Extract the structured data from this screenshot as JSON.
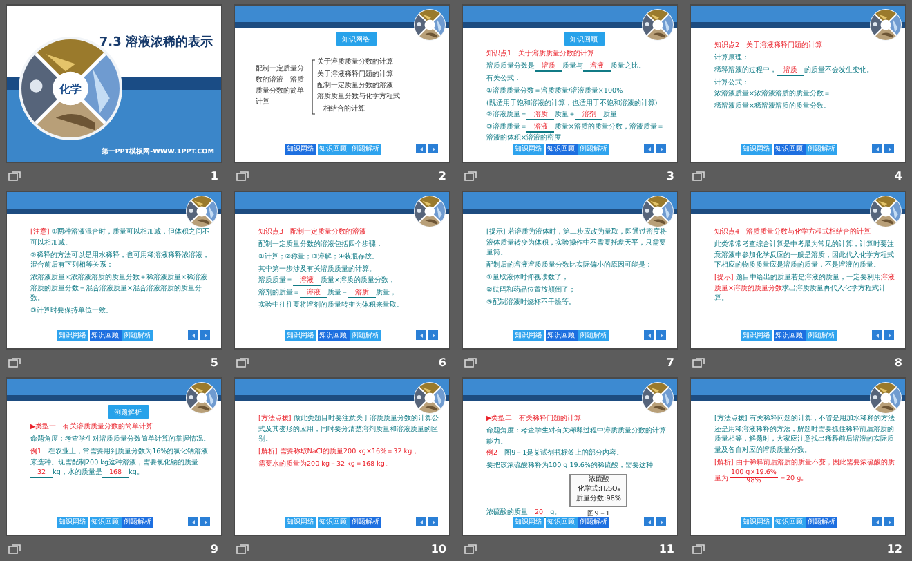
{
  "slides": [
    {
      "number": "1",
      "kind": "title",
      "title": "7.3  溶液浓稀的表示",
      "badge": "化学",
      "credit": "第一PPT模板网-WWW.1PPT.COM"
    },
    {
      "number": "2",
      "kind": "map",
      "heading": "知识网络",
      "map": {
        "topic": "配制一定质量分数的溶液　溶质质量分数的简单计算",
        "branches": [
          "关于溶质质量分数的计算",
          "关于溶液稀释问题的计算",
          "配制一定质量分数的溶液",
          "溶质质量分数与化学方程式相结合的计算"
        ]
      },
      "nav": [
        {
          "label": "知识网络",
          "selected": true
        },
        {
          "label": "知识回顾",
          "selected": false
        },
        {
          "label": "例题解析",
          "selected": false
        }
      ]
    },
    {
      "number": "3",
      "kind": "text",
      "heading": "知识回顾",
      "lines": [
        [
          {
            "kind": "red",
            "text": "知识点1　关于溶质质量分数的计算"
          }
        ],
        [
          {
            "kind": "text",
            "text": "溶质质量分数是"
          },
          {
            "kind": "blank",
            "text": "溶质"
          },
          {
            "kind": "text",
            "text": "质量与"
          },
          {
            "kind": "blank",
            "text": "溶液"
          },
          {
            "kind": "text",
            "text": "质量之比。"
          }
        ],
        [
          {
            "kind": "text",
            "text": "有关公式："
          }
        ],
        [
          {
            "kind": "text",
            "text": "①溶质质量分数＝溶质质量/溶液质量×100%"
          }
        ],
        [
          {
            "kind": "text",
            "text": "(既适用于饱和溶液的计算，也适用于不饱和溶液的计算)"
          }
        ],
        [
          {
            "kind": "text",
            "text": "②溶液质量＝"
          },
          {
            "kind": "blank",
            "text": "溶质"
          },
          {
            "kind": "text",
            "text": "质量＋"
          },
          {
            "kind": "blank",
            "text": "溶剂"
          },
          {
            "kind": "text",
            "text": "质量"
          }
        ],
        [
          {
            "kind": "text",
            "text": "③溶质质量＝"
          },
          {
            "kind": "blank",
            "text": "溶液"
          },
          {
            "kind": "text",
            "text": "质量×溶质的质量分数，溶液质量＝溶液的体积×溶液的密度"
          }
        ]
      ],
      "nav": [
        {
          "label": "知识网络",
          "selected": false
        },
        {
          "label": "知识回顾",
          "selected": true
        },
        {
          "label": "例题解析",
          "selected": false
        }
      ]
    },
    {
      "number": "4",
      "kind": "text",
      "lines": [
        [
          {
            "kind": "red",
            "text": "知识点2　关于溶液稀释问题的计算"
          }
        ],
        [
          {
            "kind": "text",
            "text": "计算原理："
          }
        ],
        [
          {
            "kind": "text",
            "text": "稀释溶液的过程中，"
          },
          {
            "kind": "blank",
            "text": "溶质"
          },
          {
            "kind": "text",
            "text": "的质量不会发生变化。"
          }
        ],
        [
          {
            "kind": "text",
            "text": "计算公式："
          }
        ],
        [
          {
            "kind": "text",
            "text": "浓溶液质量×浓溶液溶质的质量分数＝"
          }
        ],
        [
          {
            "kind": "text",
            "text": "稀溶液质量×稀溶液溶质的质量分数。"
          }
        ]
      ],
      "nav": [
        {
          "label": "知识网络",
          "selected": false
        },
        {
          "label": "知识回顾",
          "selected": true
        },
        {
          "label": "例题解析",
          "selected": false
        }
      ]
    },
    {
      "number": "5",
      "kind": "text",
      "lines": [
        [
          {
            "kind": "red",
            "text": "[注意]"
          },
          {
            "kind": "text",
            "text": " ①两种溶液混合时，质量可以相加减，但体积之间不可以相加减。"
          }
        ],
        [
          {
            "kind": "text",
            "text": "②稀释的方法可以是用水稀释，也可用稀溶液稀释浓溶液，混合前后有下列相等关系："
          }
        ],
        [
          {
            "kind": "text",
            "text": "浓溶液质量×浓溶液溶质的质量分数＋稀溶液质量×稀溶液溶质的质量分数＝混合溶液质量×混合溶液溶质的质量分数。"
          }
        ],
        [
          {
            "kind": "text",
            "text": "③计算时要保持单位一致。"
          }
        ]
      ],
      "nav": [
        {
          "label": "知识网络",
          "selected": false
        },
        {
          "label": "知识回顾",
          "selected": true
        },
        {
          "label": "例题解析",
          "selected": false
        }
      ]
    },
    {
      "number": "6",
      "kind": "text",
      "lines": [
        [
          {
            "kind": "red",
            "text": "知识点3　配制一定质量分数的溶液"
          }
        ],
        [
          {
            "kind": "text",
            "text": "配制一定质量分数的溶液包括四个步骤："
          }
        ],
        [
          {
            "kind": "text",
            "text": "①计算；②称量；③溶解；④装瓶存放。"
          }
        ],
        [
          {
            "kind": "text",
            "text": "其中第一步涉及有关溶质质量的计算。"
          }
        ],
        [
          {
            "kind": "text",
            "text": "溶质质量＝"
          },
          {
            "kind": "blank",
            "text": "溶液"
          },
          {
            "kind": "text",
            "text": "质量×溶质的质量分数，"
          }
        ],
        [
          {
            "kind": "text",
            "text": "溶剂的质量＝"
          },
          {
            "kind": "blank",
            "text": "溶液"
          },
          {
            "kind": "text",
            "text": "质量－"
          },
          {
            "kind": "blank",
            "text": "溶质"
          },
          {
            "kind": "text",
            "text": "质量，"
          }
        ],
        [
          {
            "kind": "text",
            "text": "实验中往往要将溶剂的质量转变为体积来量取。"
          }
        ]
      ],
      "nav": [
        {
          "label": "知识网络",
          "selected": false
        },
        {
          "label": "知识回顾",
          "selected": true
        },
        {
          "label": "例题解析",
          "selected": false
        }
      ]
    },
    {
      "number": "7",
      "kind": "text",
      "lines": [
        [
          {
            "kind": "text",
            "text": "[提示] 若溶质为液体时，第二步应改为量取，即通过密度将液体质量转变为体积，实验操作中不需要托盘天平，只需要量筒。"
          }
        ],
        [
          {
            "kind": "text",
            "text": "配制后的溶液溶质质量分数比实际偏小的原因可能是："
          }
        ],
        [
          {
            "kind": "text",
            "text": "①量取液体时仰视读数了；"
          }
        ],
        [
          {
            "kind": "text",
            "text": "②砝码和药品位置放颠倒了；"
          }
        ],
        [
          {
            "kind": "text",
            "text": "③配制溶液时烧杯不干燥等。"
          }
        ]
      ],
      "nav": [
        {
          "label": "知识网络",
          "selected": false
        },
        {
          "label": "知识回顾",
          "selected": true
        },
        {
          "label": "例题解析",
          "selected": false
        }
      ]
    },
    {
      "number": "8",
      "kind": "text",
      "lines": [
        [
          {
            "kind": "red",
            "text": "知识点4　溶质质量分数与化学方程式相结合的计算"
          }
        ],
        [
          {
            "kind": "text",
            "text": "此类常常考查综合计算是中考最为常见的计算，计算时要注意溶液中参加化学反应的一般是溶质，因此代入化学方程式下相应的物质质量应是溶质的质量，不是溶液的质量。"
          }
        ],
        [
          {
            "kind": "red",
            "text": "[提示]"
          },
          {
            "kind": "text",
            "text": " 题目中给出的质量若是溶液的质量，一定要利用"
          },
          {
            "kind": "red",
            "text": "溶液质量×溶质的质量分数"
          },
          {
            "kind": "text",
            "text": "求出溶质质量再代入化学方程式计算。"
          }
        ]
      ],
      "nav": [
        {
          "label": "知识网络",
          "selected": false
        },
        {
          "label": "知识回顾",
          "selected": true
        },
        {
          "label": "例题解析",
          "selected": false
        }
      ]
    },
    {
      "number": "9",
      "kind": "text",
      "heading": "例题解析",
      "lines": [
        [
          {
            "kind": "red",
            "text": "▶类型一　有关溶质质量分数的简单计算"
          }
        ],
        [
          {
            "kind": "text",
            "text": "命题角度：考查学生对溶质质量分数简单计算的掌握情况。"
          }
        ],
        [
          {
            "kind": "red",
            "text": "例1"
          },
          {
            "kind": "text",
            "text": "　在农业上，常需要用到质量分数为16%的氯化钠溶液来选种。现需配制200 kg这种溶液，需要氯化钠的质量"
          },
          {
            "kind": "blank",
            "text": "32"
          },
          {
            "kind": "text",
            "text": "kg，水的质量是"
          },
          {
            "kind": "blank",
            "text": "168"
          },
          {
            "kind": "text",
            "text": "kg。"
          }
        ]
      ],
      "nav": [
        {
          "label": "知识网络",
          "selected": false
        },
        {
          "label": "知识回顾",
          "selected": false
        },
        {
          "label": "例题解析",
          "selected": true
        }
      ]
    },
    {
      "number": "10",
      "kind": "text",
      "lines": [
        [
          {
            "kind": "red",
            "text": "[方法点拨]"
          },
          {
            "kind": "text",
            "text": " 做此类题目时要注意关于溶质质量分数的计算公式及其变形的应用，同时要分清楚溶剂质量和溶液质量的区别。"
          }
        ],
        [
          {
            "kind": "red",
            "text": "[解析] 需要称取NaCl的质量200 kg×16%＝32 kg，"
          }
        ],
        [
          {
            "kind": "red",
            "text": "需要水的质量为200 kg－32 kg＝168 kg。"
          }
        ]
      ],
      "nav": [
        {
          "label": "知识网络",
          "selected": false
        },
        {
          "label": "知识回顾",
          "selected": false
        },
        {
          "label": "例题解析",
          "selected": true
        }
      ]
    },
    {
      "number": "11",
      "kind": "text",
      "lines": [
        [
          {
            "kind": "red",
            "text": "▶类型二　有关稀释问题的计算"
          }
        ],
        [
          {
            "kind": "text",
            "text": "命题角度：考查学生对有关稀释过程中溶质质量分数的计算能力。"
          }
        ],
        [
          {
            "kind": "red",
            "text": "例2"
          },
          {
            "kind": "text",
            "text": "　图9－1是某试剂瓶标签上的部分内容。"
          }
        ],
        [
          {
            "kind": "text",
            "text": "要把该浓硫酸稀释为100 g 19.6%的稀硫酸，需要这种"
          }
        ],
        [
          {
            "kind": "text",
            "text": "浓硫酸的质量"
          },
          {
            "kind": "blank",
            "text": "20"
          },
          {
            "kind": "text",
            "text": "g。"
          }
        ]
      ],
      "figure": {
        "lines": [
          "浓硫酸",
          "化学式:H₂SO₄",
          "质量分数:98%"
        ],
        "caption": "图9－1"
      },
      "nav": [
        {
          "label": "知识网络",
          "selected": false
        },
        {
          "label": "知识回顾",
          "selected": false
        },
        {
          "label": "例题解析",
          "selected": true
        }
      ]
    },
    {
      "number": "12",
      "kind": "text",
      "lines": [
        [
          {
            "kind": "text",
            "text": "[方法点拨] 有关稀释问题的计算，不管是用加水稀释的方法还是用稀溶液稀释的方法，解题时需要抓住稀释前后溶质的质量相等，解题时，大家应注意找出稀释前后溶液的实际质量及各自对应的溶质质量分数。"
          }
        ],
        [
          {
            "kind": "red",
            "text": "[解析] 由于稀释前后溶质的质量不变，因此需要浓硫酸的质量为"
          },
          {
            "kind": "fraction",
            "numerator": "100 g×19.6%",
            "denominator": "98%"
          },
          {
            "kind": "red",
            "text": "＝20 g。"
          }
        ]
      ],
      "nav": [
        {
          "label": "知识网络",
          "selected": false
        },
        {
          "label": "知识回顾",
          "selected": false
        },
        {
          "label": "例题解析",
          "selected": true
        }
      ]
    }
  ]
}
